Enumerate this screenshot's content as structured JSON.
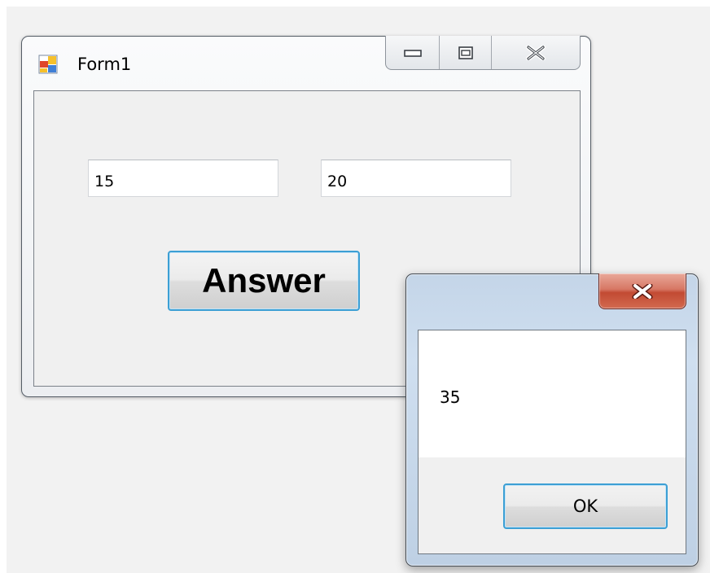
{
  "form": {
    "title": "Form1",
    "textbox1_value": "15",
    "textbox2_value": "20",
    "answer_button_label": "Answer",
    "icon": "app-form-icon",
    "caption_icons": [
      "minimize-icon",
      "restore-icon",
      "close-icon"
    ]
  },
  "message_box": {
    "text": "35",
    "ok_label": "OK",
    "close_icon": "close-icon",
    "close_button_color": "#c84a33"
  },
  "colors": {
    "focus_border": "#3c9fd4",
    "window_background": "#f0f0f0"
  }
}
